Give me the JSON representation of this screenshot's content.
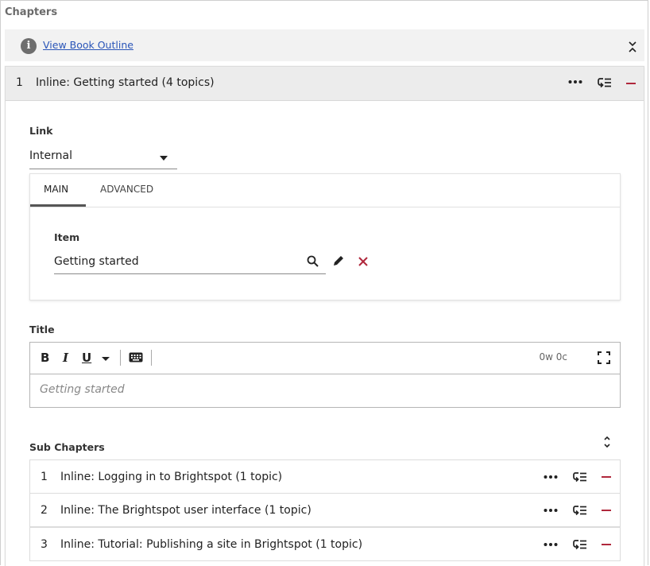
{
  "section": {
    "title": "Chapters"
  },
  "outline": {
    "info_icon_glyph": "i",
    "link_label": "View Book Outline"
  },
  "chapter": {
    "number": "1",
    "title": "Inline: Getting started (4 topics)",
    "link": {
      "label": "Link",
      "selected": "Internal"
    },
    "tabs": [
      {
        "label": "MAIN",
        "active": true
      },
      {
        "label": "ADVANCED",
        "active": false
      }
    ],
    "item": {
      "label": "Item",
      "value": "Getting started"
    },
    "title_field": {
      "label": "Title",
      "toolbar": {
        "bold": "B",
        "italic": "I",
        "underline": "U",
        "count": "0w 0c"
      },
      "value": "Getting started"
    },
    "sub_chapters": {
      "label": "Sub Chapters",
      "items": [
        {
          "number": "1",
          "title": "Inline: Logging in to Brightspot (1 topic)"
        },
        {
          "number": "2",
          "title": "Inline: The Brightspot user interface (1 topic)"
        },
        {
          "number": "3",
          "title": "Inline: Tutorial: Publishing a site in Brightspot (1 topic)"
        }
      ]
    }
  },
  "colors": {
    "link": "#2a55b8",
    "remove": "#b0283c",
    "header_bg": "#ececec"
  }
}
